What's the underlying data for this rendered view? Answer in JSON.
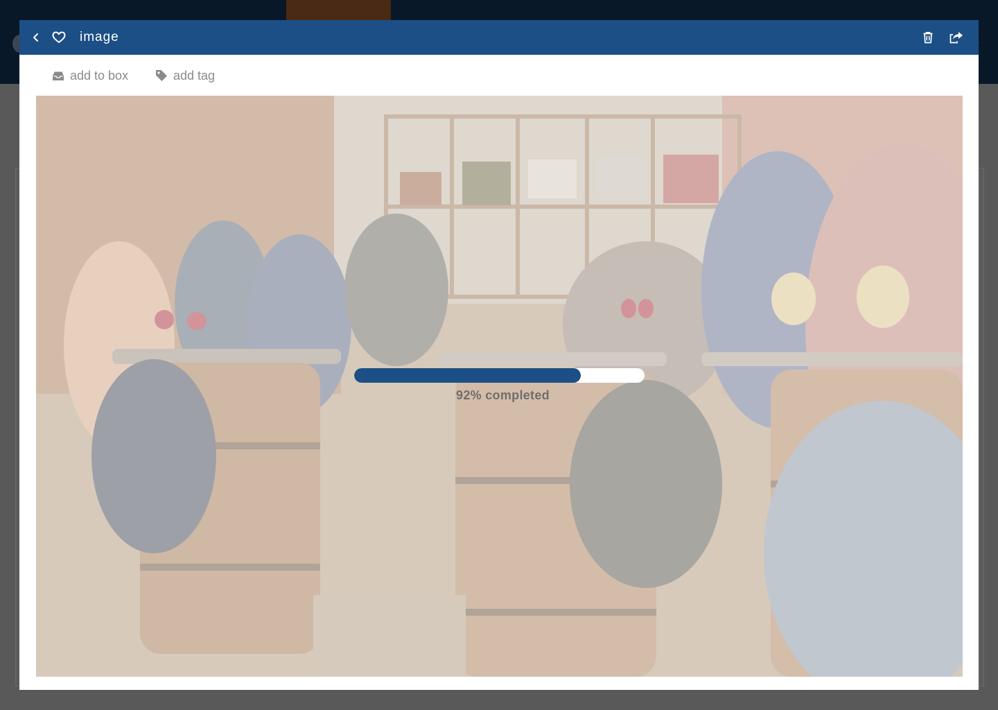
{
  "modal": {
    "title": "image",
    "icons": {
      "back": "chevron-left-icon",
      "favorite": "heart-icon",
      "delete": "trash-icon",
      "share": "share-icon"
    }
  },
  "toolbar": {
    "add_to_box_label": "add to box",
    "add_to_box_icon": "inbox-icon",
    "add_tag_label": "add tag",
    "add_tag_icon": "tag-icon"
  },
  "upload": {
    "progress_percent": 78,
    "status_text": "92% completed"
  },
  "preview": {
    "image_subject": "people sitting at wine barrel tables in a bar"
  },
  "colors": {
    "header": "#1c4f85",
    "progress": "#1c4f85",
    "background_topbar": "#081829",
    "overlay": "#595959"
  }
}
